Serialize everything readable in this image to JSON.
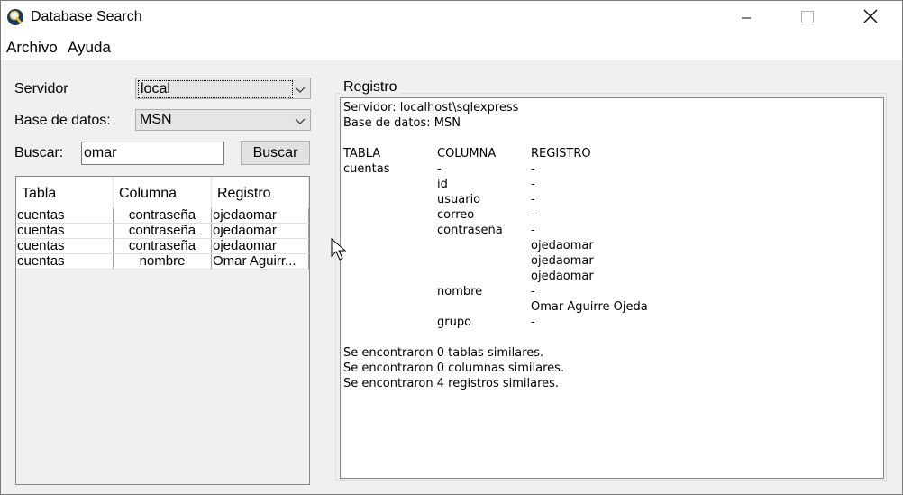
{
  "window": {
    "title": "Database Search"
  },
  "menu": {
    "items": [
      "Archivo",
      "Ayuda"
    ]
  },
  "form": {
    "servidor_label": "Servidor",
    "servidor_value": "local",
    "base_label": "Base de datos:",
    "base_value": "MSN",
    "buscar_label": "Buscar:",
    "buscar_value": "omar",
    "buscar_button": "Buscar"
  },
  "results": {
    "columns": [
      "Tabla",
      "Columna",
      "Registro"
    ],
    "rows": [
      [
        "cuentas",
        "contraseña",
        "ojedaomar"
      ],
      [
        "cuentas",
        "contraseña",
        "ojedaomar"
      ],
      [
        "cuentas",
        "contraseña",
        "ojedaomar"
      ],
      [
        "cuentas",
        "nombre",
        "Omar Aguirr..."
      ]
    ]
  },
  "registro": {
    "title": "Registro",
    "servidor_line": "Servidor: localhost\\sqlexpress",
    "base_line": "Base de datos: MSN",
    "headers": [
      "TABLA",
      "COLUMNA",
      "REGISTRO"
    ],
    "lines": [
      [
        "cuentas",
        "-",
        "-"
      ],
      [
        "",
        "id",
        "-"
      ],
      [
        "",
        "usuario",
        "-"
      ],
      [
        "",
        "correo",
        "-"
      ],
      [
        "",
        "contraseña",
        "-"
      ],
      [
        "",
        "",
        "ojedaomar"
      ],
      [
        "",
        "",
        "ojedaomar"
      ],
      [
        "",
        "",
        "ojedaomar"
      ],
      [
        "",
        "nombre",
        "-"
      ],
      [
        "",
        "",
        "Omar Aguirre Ojeda"
      ],
      [
        "",
        "grupo",
        "-"
      ]
    ],
    "summary": [
      "Se encontraron 0 tablas similares.",
      "Se encontraron 0 columnas similares.",
      "Se encontraron 4 registros similares."
    ]
  },
  "colors": {
    "accent": "#0078d7",
    "window_bg": "#f0f0f0"
  },
  "icons": {
    "app": "magnifier-icon",
    "minimize": "minimize-icon",
    "maximize": "maximize-icon",
    "close": "close-icon"
  }
}
